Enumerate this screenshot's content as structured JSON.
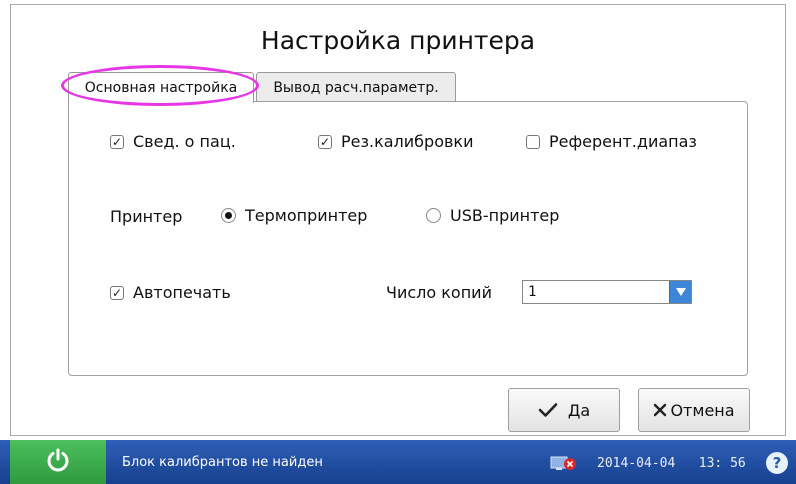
{
  "window": {
    "title": "Настройка принтера"
  },
  "tabs": [
    {
      "label": "Основная настройка",
      "active": true
    },
    {
      "label": "Вывод расч.параметр.",
      "active": false
    }
  ],
  "options": {
    "patient_info": {
      "label": "Свед. о пац.",
      "checked": true
    },
    "calibration_results": {
      "label": "Рез.калибровки",
      "checked": true
    },
    "reference_range": {
      "label": "Референт.диапаз",
      "checked": false
    }
  },
  "printer": {
    "label": "Принтер",
    "choices": [
      {
        "label": "Термопринтер",
        "selected": true
      },
      {
        "label": "USB-принтер",
        "selected": false
      }
    ]
  },
  "autoprint": {
    "label": "Автопечать",
    "checked": true
  },
  "copies": {
    "label": "Число копий",
    "value": "1"
  },
  "buttons": {
    "ok": "Да",
    "cancel": "Отмена"
  },
  "status": {
    "message": "Блок калибрантов не найден",
    "date": "2014-04-04",
    "time": "13: 56",
    "help": "?"
  },
  "colors": {
    "tab_highlight": "#e636e6",
    "status_bar": "#1f4ea3",
    "power": "#3fae4f",
    "select_arrow": "#3d86d8"
  }
}
